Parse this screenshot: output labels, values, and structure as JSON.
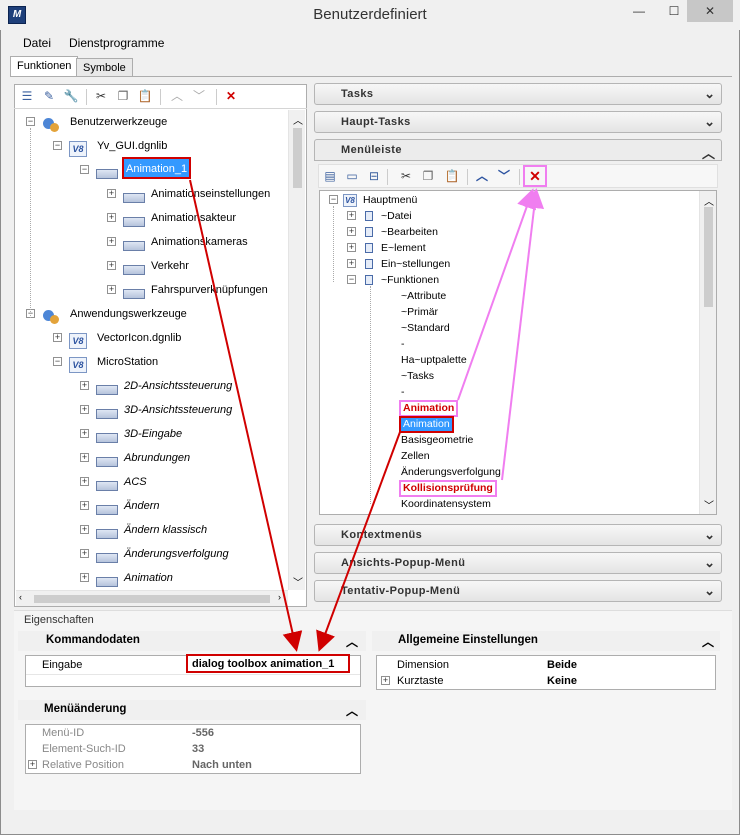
{
  "window": {
    "title": "Benutzerdefiniert",
    "logo": "M",
    "controls": [
      "minimize-icon",
      "maximize-icon",
      "close-icon"
    ]
  },
  "menubar": {
    "items": [
      "Datei",
      "Dienstprogramme"
    ]
  },
  "tabs": [
    "Funktionen",
    "Symbole"
  ],
  "left_toolbar": {
    "icons": [
      "new-tool-icon",
      "edit-icon",
      "wrench-icon",
      "cut-icon",
      "copy-icon",
      "paste-icon",
      "move-up-icon",
      "move-down-icon",
      "delete-icon"
    ]
  },
  "left_tree": {
    "items": [
      {
        "label": "Benutzerwerkzeuge",
        "icon": "tools-icon",
        "expander": "−",
        "italic": false
      },
      {
        "label": "Yv_GUI.dgnlib",
        "icon": "v8",
        "expander": "−",
        "italic": false
      },
      {
        "label": "Animation_1",
        "icon": "menu",
        "expander": "−",
        "italic": false,
        "selected": true
      },
      {
        "label": "Animationseinstellungen",
        "icon": "menu",
        "expander": "+",
        "italic": false
      },
      {
        "label": "Animationsakteur",
        "icon": "menu",
        "expander": "+",
        "italic": false
      },
      {
        "label": "Animationskameras",
        "icon": "menu",
        "expander": "+",
        "italic": false
      },
      {
        "label": "Verkehr",
        "icon": "menu",
        "expander": "+",
        "italic": false
      },
      {
        "label": "Fahrspurverknüpfungen",
        "icon": "menu",
        "expander": "+",
        "italic": false
      },
      {
        "label": "Anwendungswerkzeuge",
        "icon": "tools-icon",
        "expander": "−",
        "italic": false
      },
      {
        "label": "VectorIcon.dgnlib",
        "icon": "v8",
        "expander": "+",
        "italic": false
      },
      {
        "label": "MicroStation",
        "icon": "v8",
        "expander": "−",
        "italic": false
      },
      {
        "label": "2D-Ansichtssteuerung",
        "icon": "menu",
        "expander": "+",
        "italic": true
      },
      {
        "label": "3D-Ansichtssteuerung",
        "icon": "menu",
        "expander": "+",
        "italic": true
      },
      {
        "label": "3D-Eingabe",
        "icon": "menu",
        "expander": "+",
        "italic": true
      },
      {
        "label": "Abrundungen",
        "icon": "menu",
        "expander": "+",
        "italic": true
      },
      {
        "label": "ACS",
        "icon": "menu",
        "expander": "+",
        "italic": true
      },
      {
        "label": "Ändern",
        "icon": "menu",
        "expander": "+",
        "italic": true
      },
      {
        "label": "Ändern klassisch",
        "icon": "menu",
        "expander": "+",
        "italic": true
      },
      {
        "label": "Änderungsverfolgung",
        "icon": "menu",
        "expander": "+",
        "italic": true
      },
      {
        "label": "Animation",
        "icon": "menu",
        "expander": "+",
        "italic": true
      }
    ]
  },
  "accordion_top": [
    "Tasks",
    "Haupt-Tasks",
    "Menüleiste"
  ],
  "accordion_bottom": [
    "Kontextmenüs",
    "Ansichts-Popup-Menü",
    "Tentativ-Popup-Menü"
  ],
  "menu_toolbar": {
    "icons": [
      "new-menu-icon",
      "rename-icon",
      "separator-icon",
      "cut-icon",
      "copy-icon",
      "paste-icon",
      "move-up-icon",
      "move-down-icon",
      "delete-icon"
    ]
  },
  "menu_tree": {
    "root": "Hauptmenü",
    "items": [
      {
        "label": "~Datei",
        "level": 1,
        "expander": "+"
      },
      {
        "label": "~Bearbeiten",
        "level": 1,
        "expander": "+"
      },
      {
        "label": "E~lement",
        "level": 1,
        "expander": "+"
      },
      {
        "label": "Ein~stellungen",
        "level": 1,
        "expander": "+"
      },
      {
        "label": "~Funktionen",
        "level": 1,
        "expander": "−"
      },
      {
        "label": "~Attribute",
        "level": 2
      },
      {
        "label": "~Primär",
        "level": 2
      },
      {
        "label": "~Standard",
        "level": 2
      },
      {
        "label": "-",
        "level": 2
      },
      {
        "label": "Ha~uptpalette",
        "level": 2
      },
      {
        "label": "~Tasks",
        "level": 2
      },
      {
        "label": "-",
        "level": 2
      },
      {
        "label": "Animation",
        "level": 2,
        "style": "red-pink"
      },
      {
        "label": "Animation",
        "level": 2,
        "style": "selected-red"
      },
      {
        "label": "Basisgeometrie",
        "level": 2
      },
      {
        "label": "Zellen",
        "level": 2
      },
      {
        "label": "Änderungsverfolgung",
        "level": 2
      },
      {
        "label": "Kollisionsprüfung",
        "level": 2,
        "style": "red-pink"
      },
      {
        "label": "Koordinatensystem",
        "level": 2
      }
    ]
  },
  "properties": {
    "title": "Eigenschaften",
    "kommandodaten": {
      "header": "Kommandodaten",
      "label": "Eingabe",
      "value": "dialog toolbox animation_1"
    },
    "allgemein": {
      "header": "Allgemeine Einstellungen",
      "rows": [
        {
          "label": "Dimension",
          "value": "Beide",
          "expander": ""
        },
        {
          "label": "Kurztaste",
          "value": "Keine",
          "expander": "+"
        }
      ]
    },
    "menuaenderung": {
      "header": "Menüänderung",
      "rows": [
        {
          "label": "Menü-ID",
          "value": "-556",
          "expander": ""
        },
        {
          "label": "Element-Such-ID",
          "value": "33",
          "expander": ""
        },
        {
          "label": "Relative Position",
          "value": "Nach unten",
          "expander": "+"
        }
      ]
    }
  },
  "colors": {
    "annotation_red": "#d00000",
    "annotation_pink": "#f07ef0",
    "selection": "#3399ff"
  }
}
